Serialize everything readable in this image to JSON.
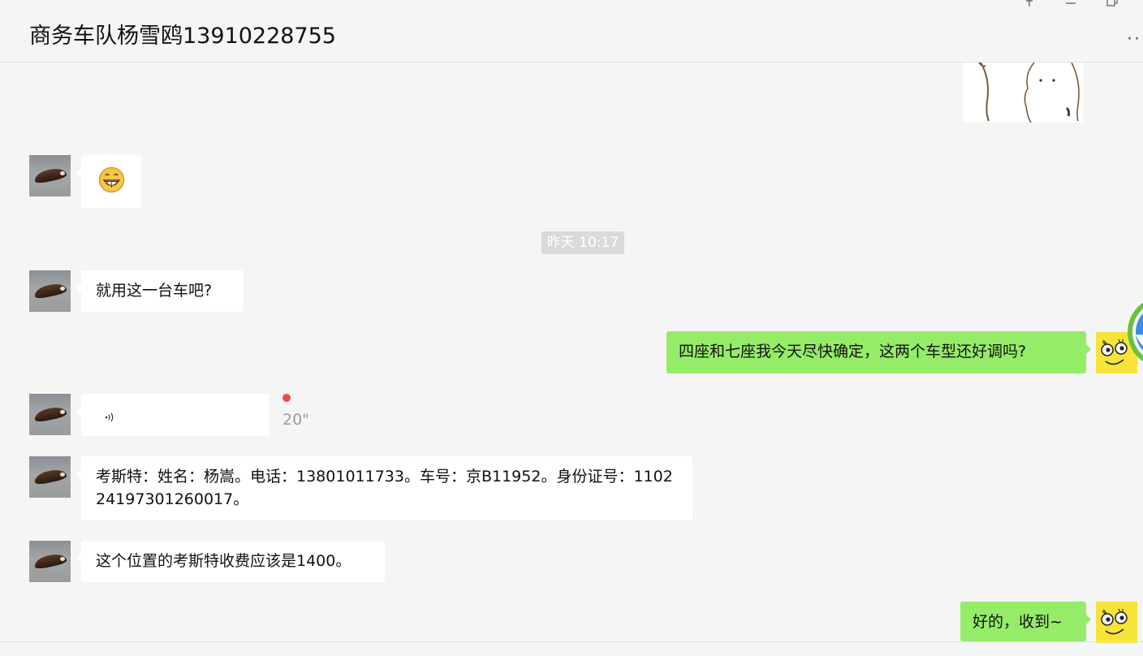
{
  "window": {
    "title": "商务车队杨雪鸥13910228755",
    "controls": {
      "pin_icon": "pin-icon",
      "minimize_icon": "minimize-icon",
      "restore_icon": "restore-icon"
    },
    "more_label": "··"
  },
  "messages": [
    {
      "side": "left",
      "type": "emoji",
      "content": "😁"
    },
    {
      "side": "left",
      "type": "text",
      "content": "就用这一台车吧?"
    },
    {
      "side": "right",
      "type": "text",
      "content": "四座和七座我今天尽快确定，这两个车型还好调吗?"
    },
    {
      "side": "left",
      "type": "voice",
      "duration": "20\"",
      "unread": true
    },
    {
      "side": "left",
      "type": "text",
      "content": "考斯特：姓名：杨嵩。电话：13801011733。车号：京B11952。身份证号：110224197301260017。"
    },
    {
      "side": "left",
      "type": "text",
      "content": "这个位置的考斯特收费应该是1400。"
    },
    {
      "side": "right",
      "type": "text",
      "content": "好的，收到~"
    }
  ],
  "timestamp": "昨天 10:17",
  "colors": {
    "background": "#f5f5f5",
    "my_bubble": "#95ec69",
    "their_bubble": "#ffffff",
    "unread_dot": "#f04848"
  }
}
